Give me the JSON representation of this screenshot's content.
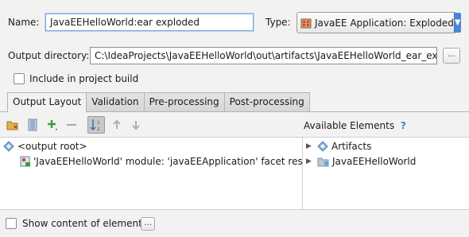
{
  "name": {
    "label": "Name:",
    "value": "JavaEEHelloWorld:ear exploded"
  },
  "type": {
    "label": "Type:",
    "value": "JavaEE Application: Exploded",
    "icon": "javaee-app-icon"
  },
  "output": {
    "label": "Output directory:",
    "value": "C:\\IdeaProjects\\JavaEEHelloWorld\\out\\artifacts\\JavaEEHelloWorld_ear_exploded",
    "browse_label": "..."
  },
  "include": {
    "label": "Include in project build",
    "checked": false
  },
  "tabs": [
    {
      "label": "Output Layout",
      "active": true
    },
    {
      "label": "Validation",
      "active": false
    },
    {
      "label": "Pre-processing",
      "active": false
    },
    {
      "label": "Post-processing",
      "active": false
    }
  ],
  "available": {
    "title": "Available Elements",
    "help": "?"
  },
  "tree": {
    "root": "<output root>",
    "item": "'JavaEEHelloWorld' module: 'javaEEApplication' facet resources"
  },
  "available_tree": [
    {
      "label": "Artifacts",
      "icon": "artifacts-icon"
    },
    {
      "label": "JavaEEHelloWorld",
      "icon": "module-folder-icon"
    }
  ],
  "show_content": {
    "label": "Show content of elements",
    "checked": false,
    "more_label": "..."
  },
  "colors": {
    "accent": "#4a86d8",
    "selection_blue": "#3f7fd9",
    "icon_green": "#3a9e3a"
  }
}
